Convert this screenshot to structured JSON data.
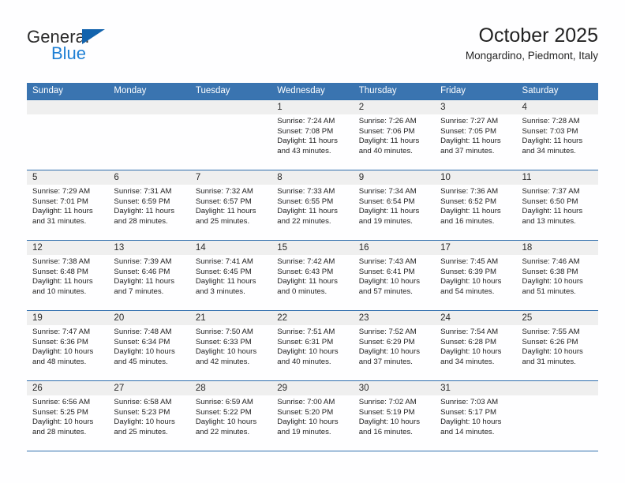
{
  "brand": {
    "name_part1": "General",
    "name_part2": "Blue",
    "logo_icon": "blue-triangle-icon",
    "color_primary": "#1263ad",
    "color_secondary": "#1e7fd4"
  },
  "header": {
    "title": "October 2025",
    "subtitle": "Mongardino, Piedmont, Italy"
  },
  "theme": {
    "header_row_bg": "#3a74b0",
    "header_row_text": "#ffffff",
    "row_border": "#2f6ead",
    "daynum_band_bg": "#efefef",
    "cell_bg": "#fefeff"
  },
  "calendar": {
    "weekday_headers": [
      "Sunday",
      "Monday",
      "Tuesday",
      "Wednesday",
      "Thursday",
      "Friday",
      "Saturday"
    ],
    "labels": {
      "sunrise": "Sunrise:",
      "sunset": "Sunset:",
      "daylight": "Daylight:"
    },
    "weeks": [
      [
        {
          "day": "",
          "line1": "",
          "line2": "",
          "line3": "",
          "line4": ""
        },
        {
          "day": "",
          "line1": "",
          "line2": "",
          "line3": "",
          "line4": ""
        },
        {
          "day": "",
          "line1": "",
          "line2": "",
          "line3": "",
          "line4": ""
        },
        {
          "day": "1",
          "line1": "Sunrise: 7:24 AM",
          "line2": "Sunset: 7:08 PM",
          "line3": "Daylight: 11 hours",
          "line4": "and 43 minutes."
        },
        {
          "day": "2",
          "line1": "Sunrise: 7:26 AM",
          "line2": "Sunset: 7:06 PM",
          "line3": "Daylight: 11 hours",
          "line4": "and 40 minutes."
        },
        {
          "day": "3",
          "line1": "Sunrise: 7:27 AM",
          "line2": "Sunset: 7:05 PM",
          "line3": "Daylight: 11 hours",
          "line4": "and 37 minutes."
        },
        {
          "day": "4",
          "line1": "Sunrise: 7:28 AM",
          "line2": "Sunset: 7:03 PM",
          "line3": "Daylight: 11 hours",
          "line4": "and 34 minutes."
        }
      ],
      [
        {
          "day": "5",
          "line1": "Sunrise: 7:29 AM",
          "line2": "Sunset: 7:01 PM",
          "line3": "Daylight: 11 hours",
          "line4": "and 31 minutes."
        },
        {
          "day": "6",
          "line1": "Sunrise: 7:31 AM",
          "line2": "Sunset: 6:59 PM",
          "line3": "Daylight: 11 hours",
          "line4": "and 28 minutes."
        },
        {
          "day": "7",
          "line1": "Sunrise: 7:32 AM",
          "line2": "Sunset: 6:57 PM",
          "line3": "Daylight: 11 hours",
          "line4": "and 25 minutes."
        },
        {
          "day": "8",
          "line1": "Sunrise: 7:33 AM",
          "line2": "Sunset: 6:55 PM",
          "line3": "Daylight: 11 hours",
          "line4": "and 22 minutes."
        },
        {
          "day": "9",
          "line1": "Sunrise: 7:34 AM",
          "line2": "Sunset: 6:54 PM",
          "line3": "Daylight: 11 hours",
          "line4": "and 19 minutes."
        },
        {
          "day": "10",
          "line1": "Sunrise: 7:36 AM",
          "line2": "Sunset: 6:52 PM",
          "line3": "Daylight: 11 hours",
          "line4": "and 16 minutes."
        },
        {
          "day": "11",
          "line1": "Sunrise: 7:37 AM",
          "line2": "Sunset: 6:50 PM",
          "line3": "Daylight: 11 hours",
          "line4": "and 13 minutes."
        }
      ],
      [
        {
          "day": "12",
          "line1": "Sunrise: 7:38 AM",
          "line2": "Sunset: 6:48 PM",
          "line3": "Daylight: 11 hours",
          "line4": "and 10 minutes."
        },
        {
          "day": "13",
          "line1": "Sunrise: 7:39 AM",
          "line2": "Sunset: 6:46 PM",
          "line3": "Daylight: 11 hours",
          "line4": "and 7 minutes."
        },
        {
          "day": "14",
          "line1": "Sunrise: 7:41 AM",
          "line2": "Sunset: 6:45 PM",
          "line3": "Daylight: 11 hours",
          "line4": "and 3 minutes."
        },
        {
          "day": "15",
          "line1": "Sunrise: 7:42 AM",
          "line2": "Sunset: 6:43 PM",
          "line3": "Daylight: 11 hours",
          "line4": "and 0 minutes."
        },
        {
          "day": "16",
          "line1": "Sunrise: 7:43 AM",
          "line2": "Sunset: 6:41 PM",
          "line3": "Daylight: 10 hours",
          "line4": "and 57 minutes."
        },
        {
          "day": "17",
          "line1": "Sunrise: 7:45 AM",
          "line2": "Sunset: 6:39 PM",
          "line3": "Daylight: 10 hours",
          "line4": "and 54 minutes."
        },
        {
          "day": "18",
          "line1": "Sunrise: 7:46 AM",
          "line2": "Sunset: 6:38 PM",
          "line3": "Daylight: 10 hours",
          "line4": "and 51 minutes."
        }
      ],
      [
        {
          "day": "19",
          "line1": "Sunrise: 7:47 AM",
          "line2": "Sunset: 6:36 PM",
          "line3": "Daylight: 10 hours",
          "line4": "and 48 minutes."
        },
        {
          "day": "20",
          "line1": "Sunrise: 7:48 AM",
          "line2": "Sunset: 6:34 PM",
          "line3": "Daylight: 10 hours",
          "line4": "and 45 minutes."
        },
        {
          "day": "21",
          "line1": "Sunrise: 7:50 AM",
          "line2": "Sunset: 6:33 PM",
          "line3": "Daylight: 10 hours",
          "line4": "and 42 minutes."
        },
        {
          "day": "22",
          "line1": "Sunrise: 7:51 AM",
          "line2": "Sunset: 6:31 PM",
          "line3": "Daylight: 10 hours",
          "line4": "and 40 minutes."
        },
        {
          "day": "23",
          "line1": "Sunrise: 7:52 AM",
          "line2": "Sunset: 6:29 PM",
          "line3": "Daylight: 10 hours",
          "line4": "and 37 minutes."
        },
        {
          "day": "24",
          "line1": "Sunrise: 7:54 AM",
          "line2": "Sunset: 6:28 PM",
          "line3": "Daylight: 10 hours",
          "line4": "and 34 minutes."
        },
        {
          "day": "25",
          "line1": "Sunrise: 7:55 AM",
          "line2": "Sunset: 6:26 PM",
          "line3": "Daylight: 10 hours",
          "line4": "and 31 minutes."
        }
      ],
      [
        {
          "day": "26",
          "line1": "Sunrise: 6:56 AM",
          "line2": "Sunset: 5:25 PM",
          "line3": "Daylight: 10 hours",
          "line4": "and 28 minutes."
        },
        {
          "day": "27",
          "line1": "Sunrise: 6:58 AM",
          "line2": "Sunset: 5:23 PM",
          "line3": "Daylight: 10 hours",
          "line4": "and 25 minutes."
        },
        {
          "day": "28",
          "line1": "Sunrise: 6:59 AM",
          "line2": "Sunset: 5:22 PM",
          "line3": "Daylight: 10 hours",
          "line4": "and 22 minutes."
        },
        {
          "day": "29",
          "line1": "Sunrise: 7:00 AM",
          "line2": "Sunset: 5:20 PM",
          "line3": "Daylight: 10 hours",
          "line4": "and 19 minutes."
        },
        {
          "day": "30",
          "line1": "Sunrise: 7:02 AM",
          "line2": "Sunset: 5:19 PM",
          "line3": "Daylight: 10 hours",
          "line4": "and 16 minutes."
        },
        {
          "day": "31",
          "line1": "Sunrise: 7:03 AM",
          "line2": "Sunset: 5:17 PM",
          "line3": "Daylight: 10 hours",
          "line4": "and 14 minutes."
        },
        {
          "day": "",
          "line1": "",
          "line2": "",
          "line3": "",
          "line4": ""
        }
      ]
    ]
  }
}
